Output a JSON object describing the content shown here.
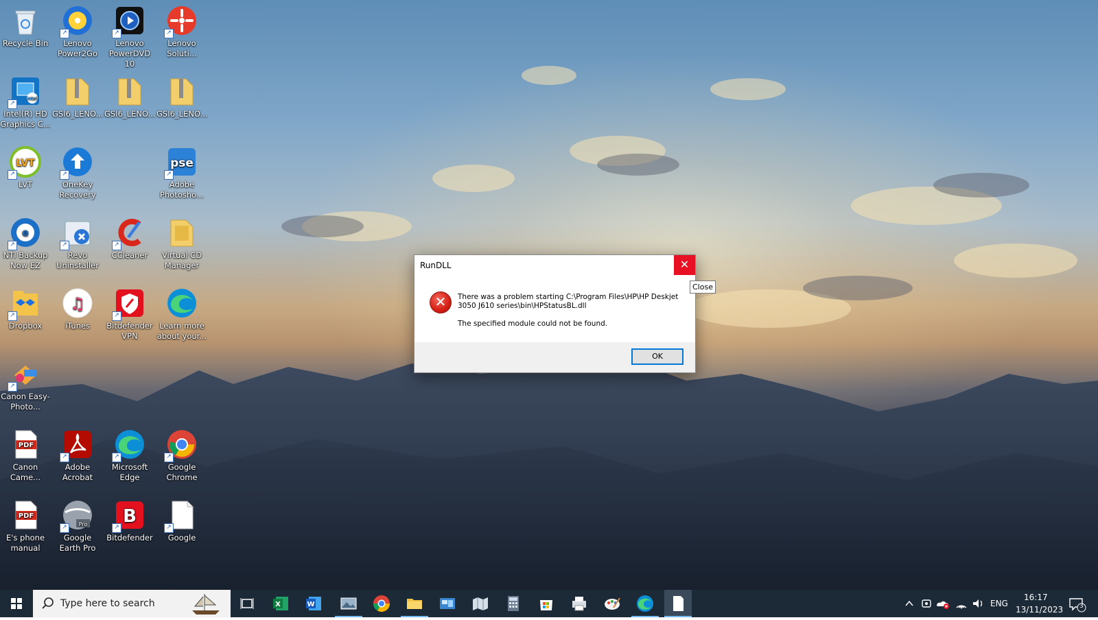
{
  "desktop": {
    "icons": [
      {
        "label": "Recycle Bin",
        "icon": "recycle-bin-icon"
      },
      {
        "label": "Lenovo Power2Go",
        "icon": "lenovo-power2go-icon"
      },
      {
        "label": "Lenovo PowerDVD 10",
        "icon": "lenovo-powerdvd-icon"
      },
      {
        "label": "Lenovo Soluti...",
        "icon": "lenovo-solution-icon"
      },
      {
        "label": "Intel(R) HD Graphics C...",
        "icon": "intel-graphics-icon"
      },
      {
        "label": "GSI6_LENO...",
        "icon": "zip-folder-icon"
      },
      {
        "label": "GSI6_LENO...",
        "icon": "zip-folder-icon"
      },
      {
        "label": "GSI6_LENO...",
        "icon": "zip-folder-icon"
      },
      {
        "label": "LVT",
        "icon": "lvt-icon"
      },
      {
        "label": "OneKey Recovery",
        "icon": "onekey-recovery-icon"
      },
      {
        "label": "Adobe Photosho...",
        "icon": "photoshop-elements-icon"
      },
      {
        "label": "NTI Backup Now EZ",
        "icon": "nti-backup-icon"
      },
      {
        "label": "Revo Uninstaller",
        "icon": "revo-uninstaller-icon"
      },
      {
        "label": "CCleaner",
        "icon": "ccleaner-icon"
      },
      {
        "label": "Virtual CD Manager",
        "icon": "folder-icon"
      },
      {
        "label": "Dropbox",
        "icon": "dropbox-icon"
      },
      {
        "label": "iTunes",
        "icon": "itunes-icon"
      },
      {
        "label": "Bitdefender VPN",
        "icon": "bitdefender-vpn-icon"
      },
      {
        "label": "Learn more about your...",
        "icon": "edge-icon"
      },
      {
        "label": "Canon Easy-Photo...",
        "icon": "canon-easy-photo-icon"
      },
      {
        "label": "Canon Came...",
        "icon": "pdf-icon"
      },
      {
        "label": "Adobe Acrobat",
        "icon": "acrobat-icon"
      },
      {
        "label": "Microsoft Edge",
        "icon": "edge-icon"
      },
      {
        "label": "Google Chrome",
        "icon": "chrome-icon"
      },
      {
        "label": "E's phone manual",
        "icon": "pdf-icon"
      },
      {
        "label": "Google Earth Pro",
        "icon": "google-earth-icon"
      },
      {
        "label": "Bitdefender",
        "icon": "bitdefender-icon"
      },
      {
        "label": "Google",
        "icon": "document-icon"
      }
    ]
  },
  "dialog": {
    "title": "RunDLL",
    "message": "There was a problem starting C:\\Program Files\\HP\\HP Deskjet 3050 J610 series\\bin\\HPStatusBL.dll",
    "detail": "The specified module could not be found.",
    "ok_label": "OK",
    "close_glyph": "✕",
    "tooltip": "Close"
  },
  "taskbar": {
    "search_placeholder": "Type here to search",
    "apps": [
      "task-view-icon",
      "excel-icon",
      "word-icon",
      "photos-icon",
      "chrome-icon",
      "file-explorer-icon",
      "control-panel-icon",
      "maps-icon",
      "calculator-icon",
      "store-icon",
      "printer-icon",
      "paint-icon",
      "edge-icon",
      "notepad-icon"
    ],
    "language": "ENG",
    "time": "16:17",
    "date": "13/11/2023",
    "notification_count": "3"
  },
  "colors": {
    "taskbar_bg": "#1c2a38",
    "close_red": "#e81123",
    "accent": "#0078d7"
  }
}
